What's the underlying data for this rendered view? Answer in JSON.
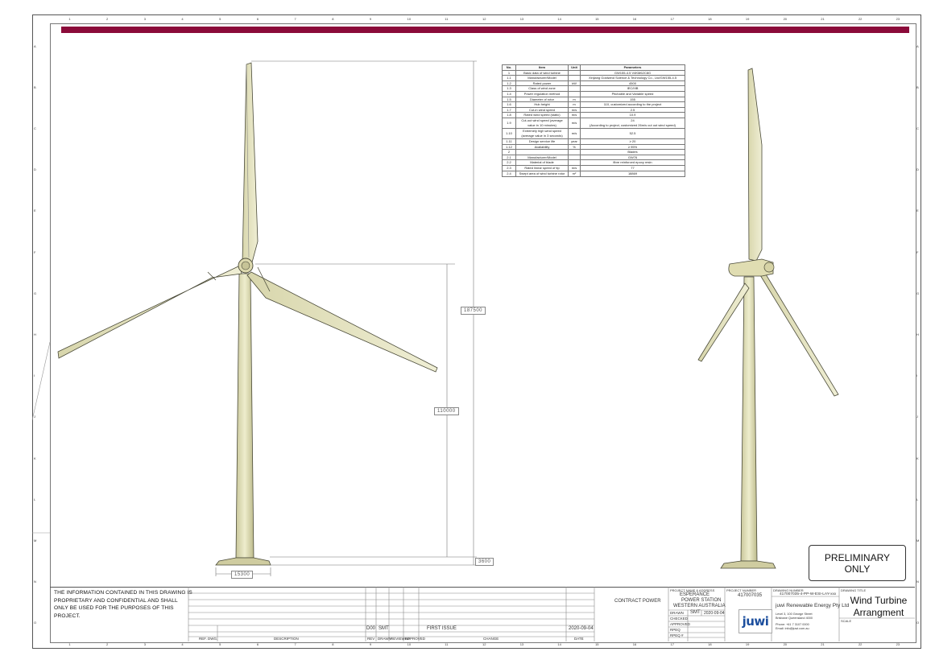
{
  "spec_table": {
    "headers": [
      "No.",
      "Item",
      "Unit",
      "Parameters"
    ],
    "rows": [
      [
        "1",
        "Basic data of wind turbine",
        "",
        "GW155-4.5 V4KM62C8G"
      ],
      [
        "1.1",
        "Manufacturer/Model",
        "",
        "Xinjiang Goldwind Science & Technology Co., Ltd/GW155-4.5"
      ],
      [
        "1.2",
        "Rated power",
        "kW",
        "4500"
      ],
      [
        "1.3",
        "Class of wind zone",
        "",
        "IEC/IIIB"
      ],
      [
        "1.4",
        "Power regulation method",
        "",
        "Pitchable and Variable speed"
      ],
      [
        "1.5",
        "Diameter of rotor",
        "m",
        "155"
      ],
      [
        "1.6",
        "Hub height",
        "m",
        "110, customized according to the project"
      ],
      [
        "1.7",
        "Cut-in wind speed",
        "m/s",
        "2.5"
      ],
      [
        "1.8",
        "Rated wind speed (static)",
        "m/s",
        "10.9"
      ],
      [
        "1.9",
        "Cut-out wind speed (average value in 10 minutes)",
        "m/s",
        "24\n(According to project, customized 26m/s cut out wind speed)"
      ],
      [
        "1.10",
        "Extremely high wind speed (average value in 3 seconds)",
        "m/s",
        "52.5"
      ],
      [
        "1.11",
        "Design service life",
        "year",
        "≥ 20"
      ],
      [
        "1.12",
        "Availability",
        "%",
        "≥ 95%"
      ],
      [
        "2",
        "",
        "",
        "Blades"
      ],
      [
        "2.1",
        "Manufacturer/Model",
        "",
        "GW76"
      ],
      [
        "2.2",
        "Material of blade",
        "",
        "fibre reinforced epoxy resin"
      ],
      [
        "2.3",
        "Rated linear speed of tip",
        "m/s",
        "77"
      ],
      [
        "2.4",
        "Swept area of wind turbine rotor",
        "m²",
        "18869"
      ]
    ]
  },
  "dimensions": {
    "total_height": "187500",
    "hub_height": "110000",
    "base_width": "15300",
    "base_height": "3600"
  },
  "prelim": {
    "line1": "PRELIMINARY",
    "line2": "ONLY"
  },
  "title_block": {
    "note": "THE INFORMATION CONTAINED IN THIS DRAWING IS PROPRIETARY AND CONFIDENTIAL AND SHALL ONLY BE USED FOR THE PURPOSES OF THIS PROJECT.",
    "ref_dwg_label": "REF. DWG.",
    "description_label": "DESCRIPTION",
    "rev_headers": [
      "REV",
      "DRAWN",
      "REVIEWED",
      "APPROVED"
    ],
    "rev_row": {
      "rev": "D00",
      "drawn": "SMT",
      "change": "FIRST ISSUE",
      "date": "2020-09-04"
    },
    "change_label": "CHANGE",
    "date_label": "DATE",
    "client": "CONTRACT POWER",
    "project_label": "PROJECT NAME & ADDRESS",
    "project_lines": [
      "ESPERANCE",
      "POWER STATION",
      "WESTERN AUSTRALIA"
    ],
    "drawn_label": "DRAWN",
    "drawn_value": "SMT",
    "drawn_date": "2020-09-04",
    "checked_label": "CHECKED",
    "approved_label": "APPROVED",
    "rpeq_label": "RPEQ",
    "rpeq_no_label": "RPEQ #",
    "project_number_label": "PROJECT NUMBER",
    "project_number": "417007035",
    "drawing_number_label": "DRAWING NUMBER",
    "drawing_number": "417007035-4-PP-W-ESI-LAY-xxx",
    "company": "juwi Renewable Energy Pty Ltd",
    "address_lines": [
      "Level 3, 100 George Street",
      "Brisbane Queensland 4000"
    ],
    "phone": "Phone: +61 7 3107 0000",
    "email": "Email:  info@juwi.com.au",
    "logo_text": "juwi",
    "drawing_title_label": "DRAWING TITLE",
    "drawing_title": [
      "Wind Turbine",
      "Arrangment"
    ],
    "scale_label": "SCALE"
  },
  "ruler": {
    "top_numbers": [
      "1",
      "2",
      "3",
      "4",
      "5",
      "6",
      "7",
      "8",
      "9",
      "10",
      "11",
      "12",
      "13",
      "14",
      "15",
      "16",
      "17",
      "18",
      "19",
      "20",
      "21",
      "22",
      "23"
    ],
    "side_letters": [
      "A",
      "B",
      "C",
      "D",
      "E",
      "F",
      "G",
      "H",
      "I",
      "J",
      "K",
      "L",
      "M",
      "N",
      "O"
    ]
  },
  "colors": {
    "accent_bar": "#8b0b3a",
    "turbine_fill": "#e4e2bd",
    "turbine_stroke": "#4a4a38"
  }
}
